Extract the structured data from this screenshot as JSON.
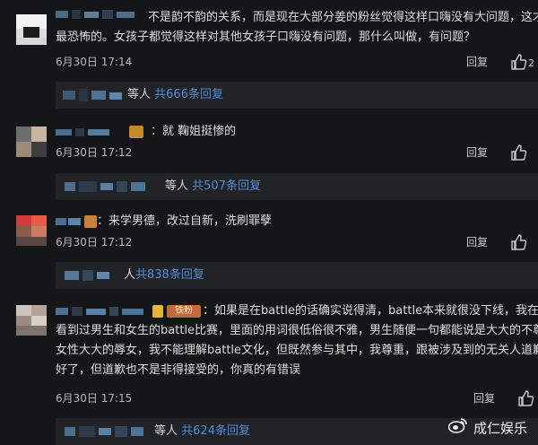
{
  "comments": [
    {
      "text_lines": [
        "不是韵不韵的关系，而是现在大部分姜的粉丝觉得这样口嗨没有大问题，这才",
        "最恐怖的。女孩子都觉得这样对其他女孩子口嗨没有问题，那什么叫做，有问题？"
      ],
      "date": "6月30日 17:14",
      "reply_label": "回复"
    },
    {
      "text": "就 鞠姐挺惨的",
      "date": "6月30日 17:12",
      "reply_label": "回复",
      "sub_prefix": "等人",
      "sub_count": "共507条回复"
    },
    {
      "text": "来学男德，改过自新，洗刷罪孽",
      "date": "6月30日 17:12",
      "reply_label": "回复",
      "sub_prefix": "人",
      "sub_count": "共838条回复"
    },
    {
      "text_lines": [
        "如果是在battle的话确实说得清，battle本来就很没下线，我在b",
        "看到过男生和女生的battle比赛，里面的用词很低俗很不雅，男生随便一句都能说是大大的不尊",
        "女性大大的辱女，我不能理解battle文化，但既然参与其中，我尊重，跟被涉及到的无关人道歉",
        "好了，但道歉也不是非得接受的，你真的有错误"
      ],
      "badge": "铁粉",
      "date": "6月30日 17:15",
      "reply_label": "回复",
      "sub_prefix": "等人",
      "sub_count": "共624条回复"
    }
  ],
  "first_sub": {
    "prefix": "等人",
    "count": "共666条回复"
  },
  "watermark": "成仁娱乐",
  "colors": {
    "background": "#151618",
    "link": "#4d8fd6",
    "subbox": "#212327"
  }
}
